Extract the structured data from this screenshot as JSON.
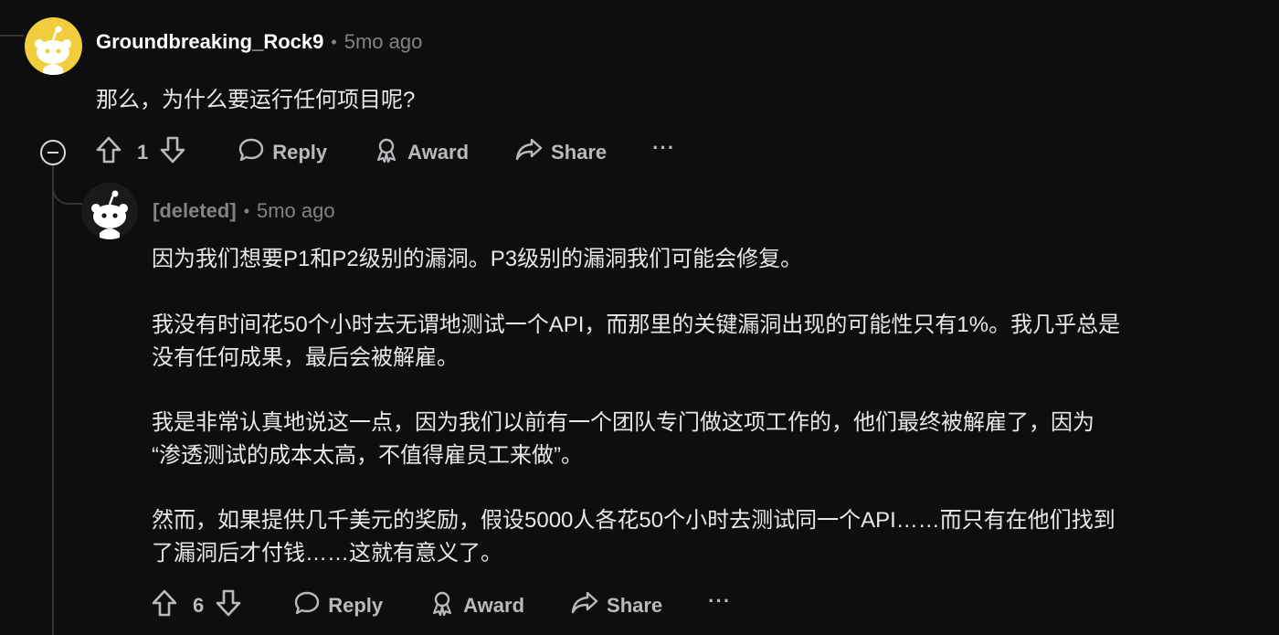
{
  "comment1": {
    "username": "Groundbreaking_Rock9",
    "separator": "•",
    "time": "5mo ago",
    "body": "那么，为什么要运行任何项目呢?",
    "votes": "1",
    "actions": {
      "reply": "Reply",
      "award": "Award",
      "share": "Share",
      "more": "···"
    }
  },
  "comment2": {
    "username": "[deleted]",
    "separator": "•",
    "time": "5mo ago",
    "paragraphs": [
      {
        "lines": [
          "因为我们想要P1和P2级别的漏洞。P3级别的漏洞我们可能会修复。"
        ]
      },
      {
        "lines": [
          "我没有时间花50个小时去无谓地测试一个API，而那里的关键漏洞出现的可能性只有1%。我几乎总是",
          "没有任何成果，最后会被解雇。"
        ]
      },
      {
        "lines": [
          "我是非常认真地说这一点，因为我们以前有一个团队专门做这项工作的，他们最终被解雇了，因为",
          "“渗透测试的成本太高，不值得雇员工来做”。"
        ]
      },
      {
        "lines": [
          "然而，如果提供几千美元的奖励，假设5000人各花50个小时去测试同一个API……而只有在他们找到",
          "了漏洞后才付钱……这就有意义了。"
        ]
      }
    ],
    "votes": "6",
    "actions": {
      "reply": "Reply",
      "award": "Award",
      "share": "Share",
      "more": "···"
    }
  }
}
